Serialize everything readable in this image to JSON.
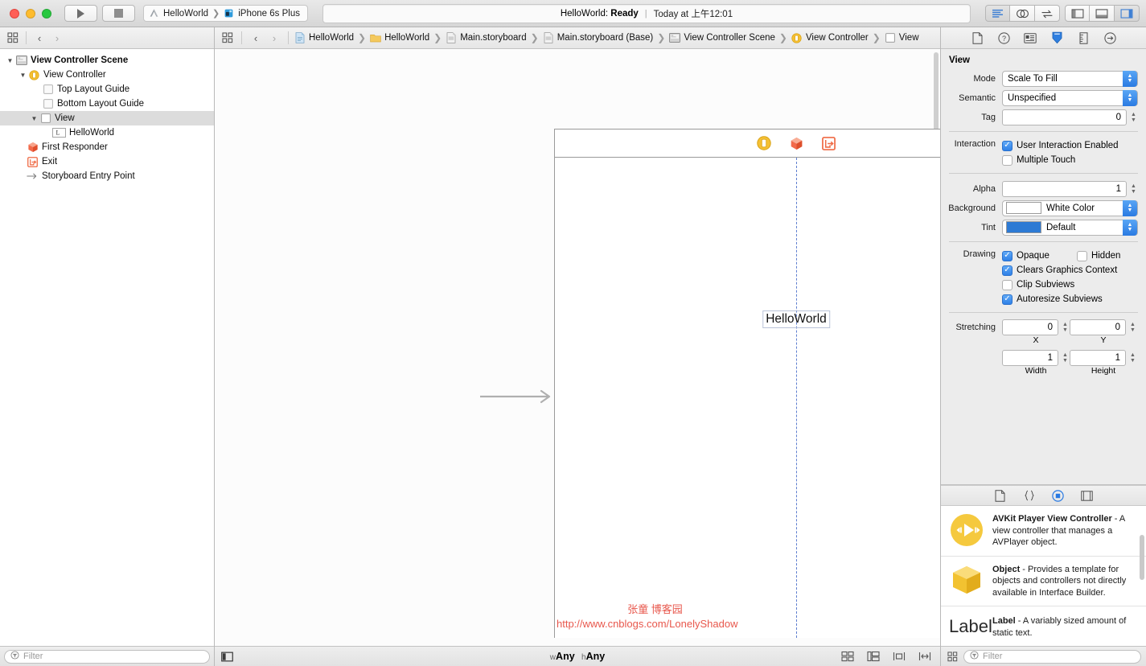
{
  "window": {
    "traffic_lights": [
      "close",
      "minimize",
      "zoom"
    ]
  },
  "toolbar": {
    "run_label": "Run",
    "stop_label": "Stop",
    "scheme_project": "HelloWorld",
    "scheme_destination": "iPhone 6s Plus",
    "status_primary_prefix": "HelloWorld: ",
    "status_primary_state": "Ready",
    "status_divider": "|",
    "status_secondary": "Today at 上午12:01",
    "editor_buttons": [
      "standard-editor",
      "assistant-editor",
      "version-editor"
    ],
    "view_buttons": [
      "navigator-toggle",
      "debug-toggle",
      "utilities-toggle"
    ]
  },
  "jumpbar": {
    "related_items_label": "Related Items",
    "back_label": "‹",
    "forward_label": "›"
  },
  "outline": {
    "items": [
      {
        "label": "View Controller Scene",
        "icon": "scene-icon",
        "depth": 0,
        "disclosure": "open",
        "bold": true,
        "selected": false
      },
      {
        "label": "View Controller",
        "icon": "view-controller-icon",
        "depth": 1,
        "disclosure": "open",
        "bold": false,
        "selected": false
      },
      {
        "label": "Top Layout Guide",
        "icon": "layout-guide-icon",
        "depth": 2,
        "disclosure": "none",
        "bold": false,
        "selected": false
      },
      {
        "label": "Bottom Layout Guide",
        "icon": "layout-guide-icon",
        "depth": 2,
        "disclosure": "none",
        "bold": false,
        "selected": false
      },
      {
        "label": "View",
        "icon": "view-icon",
        "depth": 2,
        "disclosure": "open",
        "bold": false,
        "selected": true
      },
      {
        "label": "HelloWorld",
        "icon": "label-icon",
        "depth": 3,
        "disclosure": "none",
        "bold": false,
        "selected": false
      },
      {
        "label": "First Responder",
        "icon": "first-responder-icon",
        "depth": 1,
        "disclosure": "none",
        "bold": false,
        "selected": false
      },
      {
        "label": "Exit",
        "icon": "exit-icon",
        "depth": 1,
        "disclosure": "none",
        "bold": false,
        "selected": false
      },
      {
        "label": "Storyboard Entry Point",
        "icon": "entry-point-icon",
        "depth": 1,
        "disclosure": "none",
        "bold": false,
        "selected": false
      }
    ]
  },
  "navigator_filter": {
    "placeholder": "Filter"
  },
  "breadcrumb": {
    "items": [
      {
        "label": "HelloWorld",
        "icon": "project-icon"
      },
      {
        "label": "HelloWorld",
        "icon": "folder-icon"
      },
      {
        "label": "Main.storyboard",
        "icon": "storyboard-file-icon"
      },
      {
        "label": "Main.storyboard (Base)",
        "icon": "storyboard-file-icon"
      },
      {
        "label": "View Controller Scene",
        "icon": "scene-icon"
      },
      {
        "label": "View Controller",
        "icon": "view-controller-icon"
      },
      {
        "label": "View",
        "icon": "view-icon"
      }
    ],
    "separator": "❯"
  },
  "canvas": {
    "dock_icons": [
      "view-controller-icon",
      "first-responder-icon",
      "exit-icon"
    ],
    "label_text": "HelloWorld",
    "watermark_name": "张童 博客园",
    "watermark_url": "http://www.cnblogs.com/LonelyShadow",
    "entry_point_arrow": "storyboard-entry-arrow"
  },
  "editor_bottom": {
    "size_class_w_prefix": "w",
    "size_class_w_value": "Any",
    "size_class_h_prefix": "h",
    "size_class_h_value": "Any",
    "autolayout_buttons": [
      "align-button",
      "pin-button",
      "resolve-auto-layout-issues-button",
      "resizing-behavior-button"
    ]
  },
  "inspector": {
    "tabs": [
      "file-inspector",
      "quick-help-inspector",
      "identity-inspector",
      "attributes-inspector",
      "size-inspector",
      "connections-inspector"
    ],
    "active_tab_index": 3,
    "section_title": "View",
    "mode": {
      "label": "Mode",
      "value": "Scale To Fill"
    },
    "semantic": {
      "label": "Semantic",
      "value": "Unspecified"
    },
    "tag": {
      "label": "Tag",
      "value": "0"
    },
    "interaction": {
      "label": "Interaction",
      "options": [
        {
          "label": "User Interaction Enabled",
          "checked": true
        },
        {
          "label": "Multiple Touch",
          "checked": false
        }
      ]
    },
    "alpha": {
      "label": "Alpha",
      "value": "1"
    },
    "background": {
      "label": "Background",
      "value": "White Color",
      "color": "#ffffff"
    },
    "tint": {
      "label": "Tint",
      "value": "Default",
      "color": "#2d7ad4"
    },
    "drawing": {
      "label": "Drawing",
      "options": [
        {
          "label": "Opaque",
          "checked": true
        },
        {
          "label": "Hidden",
          "checked": false
        },
        {
          "label": "Clears Graphics Context",
          "checked": true
        },
        {
          "label": "Clip Subviews",
          "checked": false
        },
        {
          "label": "Autoresize Subviews",
          "checked": true
        }
      ]
    },
    "stretching": {
      "label": "Stretching",
      "x": {
        "value": "0",
        "caption": "X"
      },
      "y": {
        "value": "0",
        "caption": "Y"
      },
      "width": {
        "value": "1",
        "caption": "Width"
      },
      "height": {
        "value": "1",
        "caption": "Height"
      }
    }
  },
  "library": {
    "tabs": [
      "file-template-library",
      "code-snippet-library",
      "object-library",
      "media-library"
    ],
    "active_tab_index": 2,
    "items": [
      {
        "title": "AVKit Player View Controller",
        "dash": " - ",
        "description": "A view controller that manages a AVPlayer object.",
        "icon": "avkit-player-icon"
      },
      {
        "title": "Object",
        "dash": " - ",
        "description": "Provides a template for objects and controllers not directly available in Interface Builder.",
        "icon": "object-cube-icon"
      },
      {
        "title": "Label",
        "dash": " - ",
        "description": "A variably sized amount of static text.",
        "icon": "label-text-icon",
        "icon_text": "Label"
      }
    ],
    "filter": {
      "placeholder": "Filter"
    },
    "grid_toggle": "library-view-mode-button"
  }
}
